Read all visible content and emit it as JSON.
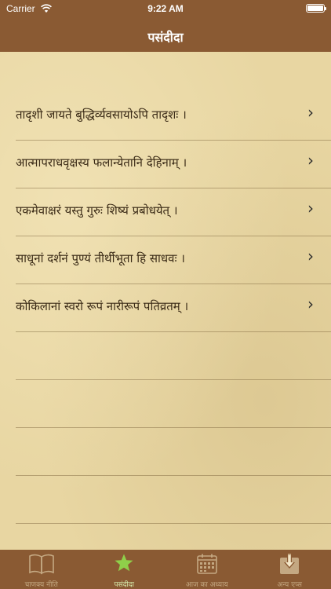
{
  "status_bar": {
    "carrier": "Carrier",
    "time": "9:22 AM"
  },
  "header": {
    "title": "पसंदीदा"
  },
  "list": {
    "items": [
      {
        "text": "तादृशी जायते बुद्धिर्व्यवसायोऽपि तादृशः ।"
      },
      {
        "text": "आत्मापराधवृक्षस्य फलान्येतानि देहिनाम् ।"
      },
      {
        "text": "एकमेवाक्षरं यस्तु गुरुः शिष्यं प्रबोधयेत् ।"
      },
      {
        "text": "साधूनां दर्शनं पुण्यं तीर्थीभूता हि साधवः ।"
      },
      {
        "text": "कोकिलानां स्वरो रूपं नारीरूपं पतिव्रतम् ।"
      }
    ]
  },
  "tabbar": {
    "tabs": [
      {
        "label": "चाणक्य नीति",
        "icon": "book-icon"
      },
      {
        "label": "पसंदीदा",
        "icon": "star-icon",
        "active": true
      },
      {
        "label": "आज का अध्याय",
        "icon": "calendar-icon"
      },
      {
        "label": "अन्य एप्स",
        "icon": "download-icon"
      }
    ]
  },
  "colors": {
    "header_bg": "#8a5a33",
    "paper": "#e8d6a2",
    "active_tab": "#8fcf4a",
    "inactive_tab": "#c4a882"
  }
}
